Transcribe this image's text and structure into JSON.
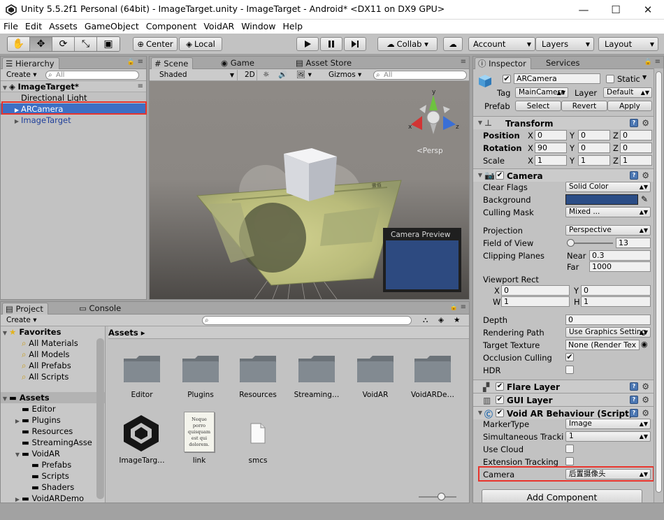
{
  "window": {
    "title": "Unity 5.5.2f1 Personal (64bit) - ImageTarget.unity - ImageTarget - Android* <DX11 on DX9 GPU>",
    "minimize": "—",
    "maximize": "☐",
    "close": "✕"
  },
  "menu": [
    "File",
    "Edit",
    "Assets",
    "GameObject",
    "Component",
    "VoidAR",
    "Window",
    "Help"
  ],
  "toolbar": {
    "center": "Center",
    "local": "Local",
    "collab": "Collab ▾",
    "account": "Account",
    "layers": "Layers",
    "layout": "Layout"
  },
  "colors": {
    "panel": "#c2c2c2",
    "selection": "#3d6fc4",
    "highlight": "#e8342c",
    "camera_background": "#2b4d86"
  },
  "hierarchy": {
    "tab": "Hierarchy",
    "create": "Create",
    "search_placeholder": "All",
    "scene": "ImageTarget*",
    "items": [
      "Directional Light",
      "ARCamera",
      "ImageTarget"
    ]
  },
  "scene": {
    "tabs": [
      "Scene",
      "Game",
      "Asset Store"
    ],
    "shading": "Shaded",
    "mode_2d": "2D",
    "gizmos": "Gizmos",
    "search_placeholder": "All",
    "persp": "<Persp",
    "axis_x": "x",
    "axis_y": "y",
    "axis_z": "z",
    "camera_preview": "Camera Preview"
  },
  "project": {
    "tabs": [
      "Project",
      "Console"
    ],
    "create": "Create",
    "favorites": "Favorites",
    "favorite_items": [
      "All Materials",
      "All Models",
      "All Prefabs",
      "All Scripts"
    ],
    "assets_root": "Assets",
    "tree": [
      "Editor",
      "Plugins",
      "Resources",
      "StreamingAsse",
      "VoidAR",
      "Prefabs",
      "Scripts",
      "Shaders",
      "VoidARDemo"
    ],
    "breadcrumb": "Assets ▸",
    "folders": [
      "Editor",
      "Plugins",
      "Resources",
      "Streaming…",
      "VoidAR",
      "VoidARDe…"
    ],
    "files": [
      "ImageTarg…",
      "link",
      "smcs"
    ],
    "doc_thumb_text": "Neque porro quisquam est qui dolorem."
  },
  "inspector": {
    "tabs": [
      "Inspector",
      "Services"
    ],
    "name": "ARCamera",
    "static_label": "Static",
    "tag_label": "Tag",
    "tag_value": "MainCamera",
    "layer_label": "Layer",
    "layer_value": "Default",
    "prefab_label": "Prefab",
    "prefab_buttons": [
      "Select",
      "Revert",
      "Apply"
    ],
    "transform": {
      "title": "Transform",
      "rows": [
        {
          "label": "Position",
          "x": "0",
          "y": "0",
          "z": "0"
        },
        {
          "label": "Rotation",
          "x": "90",
          "y": "0",
          "z": "0"
        },
        {
          "label": "Scale",
          "x": "1",
          "y": "1",
          "z": "1"
        }
      ],
      "axis_x": "X",
      "axis_y": "Y",
      "axis_z": "Z"
    },
    "camera": {
      "title": "Camera",
      "clear_flags_label": "Clear Flags",
      "clear_flags": "Solid Color",
      "background_label": "Background",
      "culling_mask_label": "Culling Mask",
      "culling_mask": "Mixed ...",
      "projection_label": "Projection",
      "projection": "Perspective",
      "fov_label": "Field of View",
      "fov": "13",
      "fov_value": 13,
      "fov_max": 179,
      "clipping_label": "Clipping Planes",
      "near_label": "Near",
      "near": "0.3",
      "far_label": "Far",
      "far": "1000",
      "viewport_label": "Viewport Rect",
      "vp_x_label": "X",
      "vp_x": "0",
      "vp_y_label": "Y",
      "vp_y": "0",
      "vp_w_label": "W",
      "vp_w": "1",
      "vp_h_label": "H",
      "vp_h": "1",
      "depth_label": "Depth",
      "depth": "0",
      "rendering_path_label": "Rendering Path",
      "rendering_path": "Use Graphics Setting",
      "target_texture_label": "Target Texture",
      "target_texture": "None (Render Tex",
      "occlusion_label": "Occlusion Culling",
      "hdr_label": "HDR"
    },
    "flare_layer": "Flare Layer",
    "gui_layer": "GUI Layer",
    "voidar": {
      "title": "Void AR Behaviour (Script)",
      "marker_type_label": "MarkerType",
      "marker_type": "Image",
      "simultaneous_label": "Simultaneous Tracki",
      "simultaneous": "1",
      "use_cloud_label": "Use Cloud",
      "extension_label": "Extension Tracking",
      "camera_label": "Camera",
      "camera_value": "后置摄像头"
    },
    "add_component": "Add Component"
  }
}
